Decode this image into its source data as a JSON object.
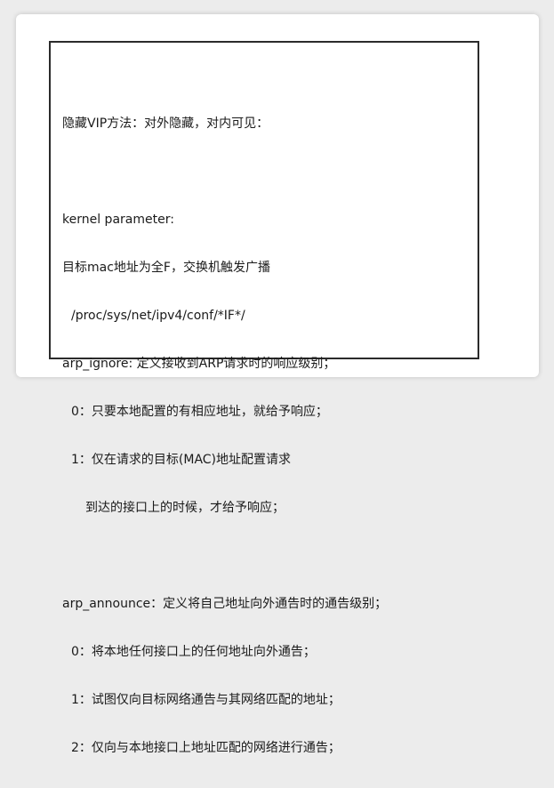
{
  "document": {
    "heading": "隐藏VIP方法：对外隐藏，对内可见：",
    "kernel_label": "kernel parameter:",
    "target_mac_note": "目标mac地址为全F，交换机触发广播",
    "proc_path": "/proc/sys/net/ipv4/conf/*IF*/",
    "arp_ignore": {
      "title": "arp_ignore: 定义接收到ARP请求时的响应级别；",
      "option_0": "0：只要本地配置的有相应地址，就给予响应；",
      "option_1_line1": "1：仅在请求的目标(MAC)地址配置请求",
      "option_1_line2": "到达的接口上的时候，才给予响应；"
    },
    "arp_announce": {
      "title": "arp_announce：定义将自己地址向外通告时的通告级别；",
      "option_0": "0：将本地任何接口上的任何地址向外通告；",
      "option_1": "1：试图仅向目标网络通告与其网络匹配的地址；",
      "option_2": "2：仅向与本地接口上地址匹配的网络进行通告；"
    }
  }
}
